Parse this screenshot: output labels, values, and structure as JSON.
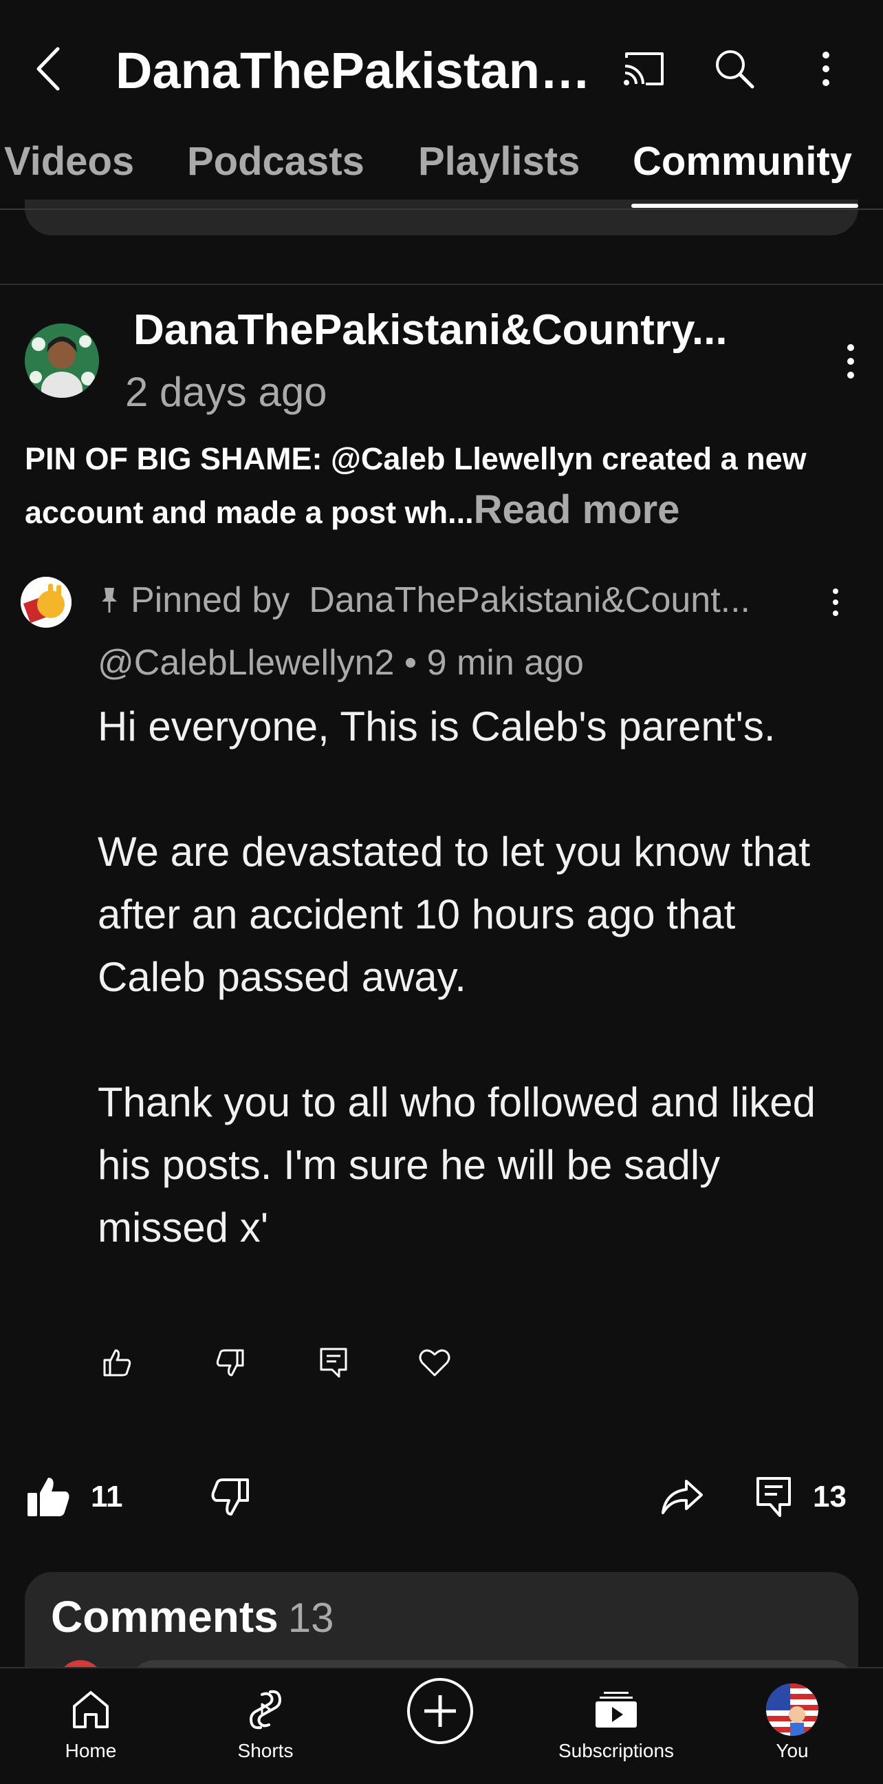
{
  "header": {
    "channel_title": "DanaThePakistani&Country Mom",
    "icons": [
      "back-arrow-icon",
      "cast-icon",
      "search-icon",
      "more-vert-icon"
    ]
  },
  "tabs": [
    {
      "label": "Videos",
      "active": false
    },
    {
      "label": "Podcasts",
      "active": false
    },
    {
      "label": "Playlists",
      "active": false
    },
    {
      "label": "Community",
      "active": true
    }
  ],
  "post": {
    "author": "DanaThePakistani&Country...",
    "time": "2 days ago",
    "text": "PIN OF BIG SHAME: @Caleb Llewellyn created a new account and made a post wh...",
    "read_more": "Read more",
    "likes": "11",
    "comments": "13"
  },
  "pinned_comment": {
    "pin_label": "Pinned by",
    "pinned_by": "DanaThePakistani&Count...",
    "author": "@CalebLlewellyn2",
    "separator": "•",
    "time": "9 min ago",
    "body": [
      "Hi everyone, This is Caleb's parent's.",
      "We are devastated to let you know that after an accident 10 hours ago that Caleb passed away.",
      "Thank you to all who followed and liked his posts.  I'm sure he will be sadly missed x'"
    ]
  },
  "comments_section": {
    "title": "Comments",
    "count": "13"
  },
  "bottom_nav": [
    {
      "label": "Home",
      "icon": "home-icon"
    },
    {
      "label": "Shorts",
      "icon": "shorts-icon"
    },
    {
      "label": "",
      "icon": "create-icon"
    },
    {
      "label": "Subscriptions",
      "icon": "subscriptions-icon"
    },
    {
      "label": "You",
      "icon": "avatar-icon"
    }
  ],
  "colors": {
    "background": "#0f0f0f",
    "card": "#272727",
    "secondary_text": "#aaaaaa",
    "primary_text": "#ffffff"
  }
}
